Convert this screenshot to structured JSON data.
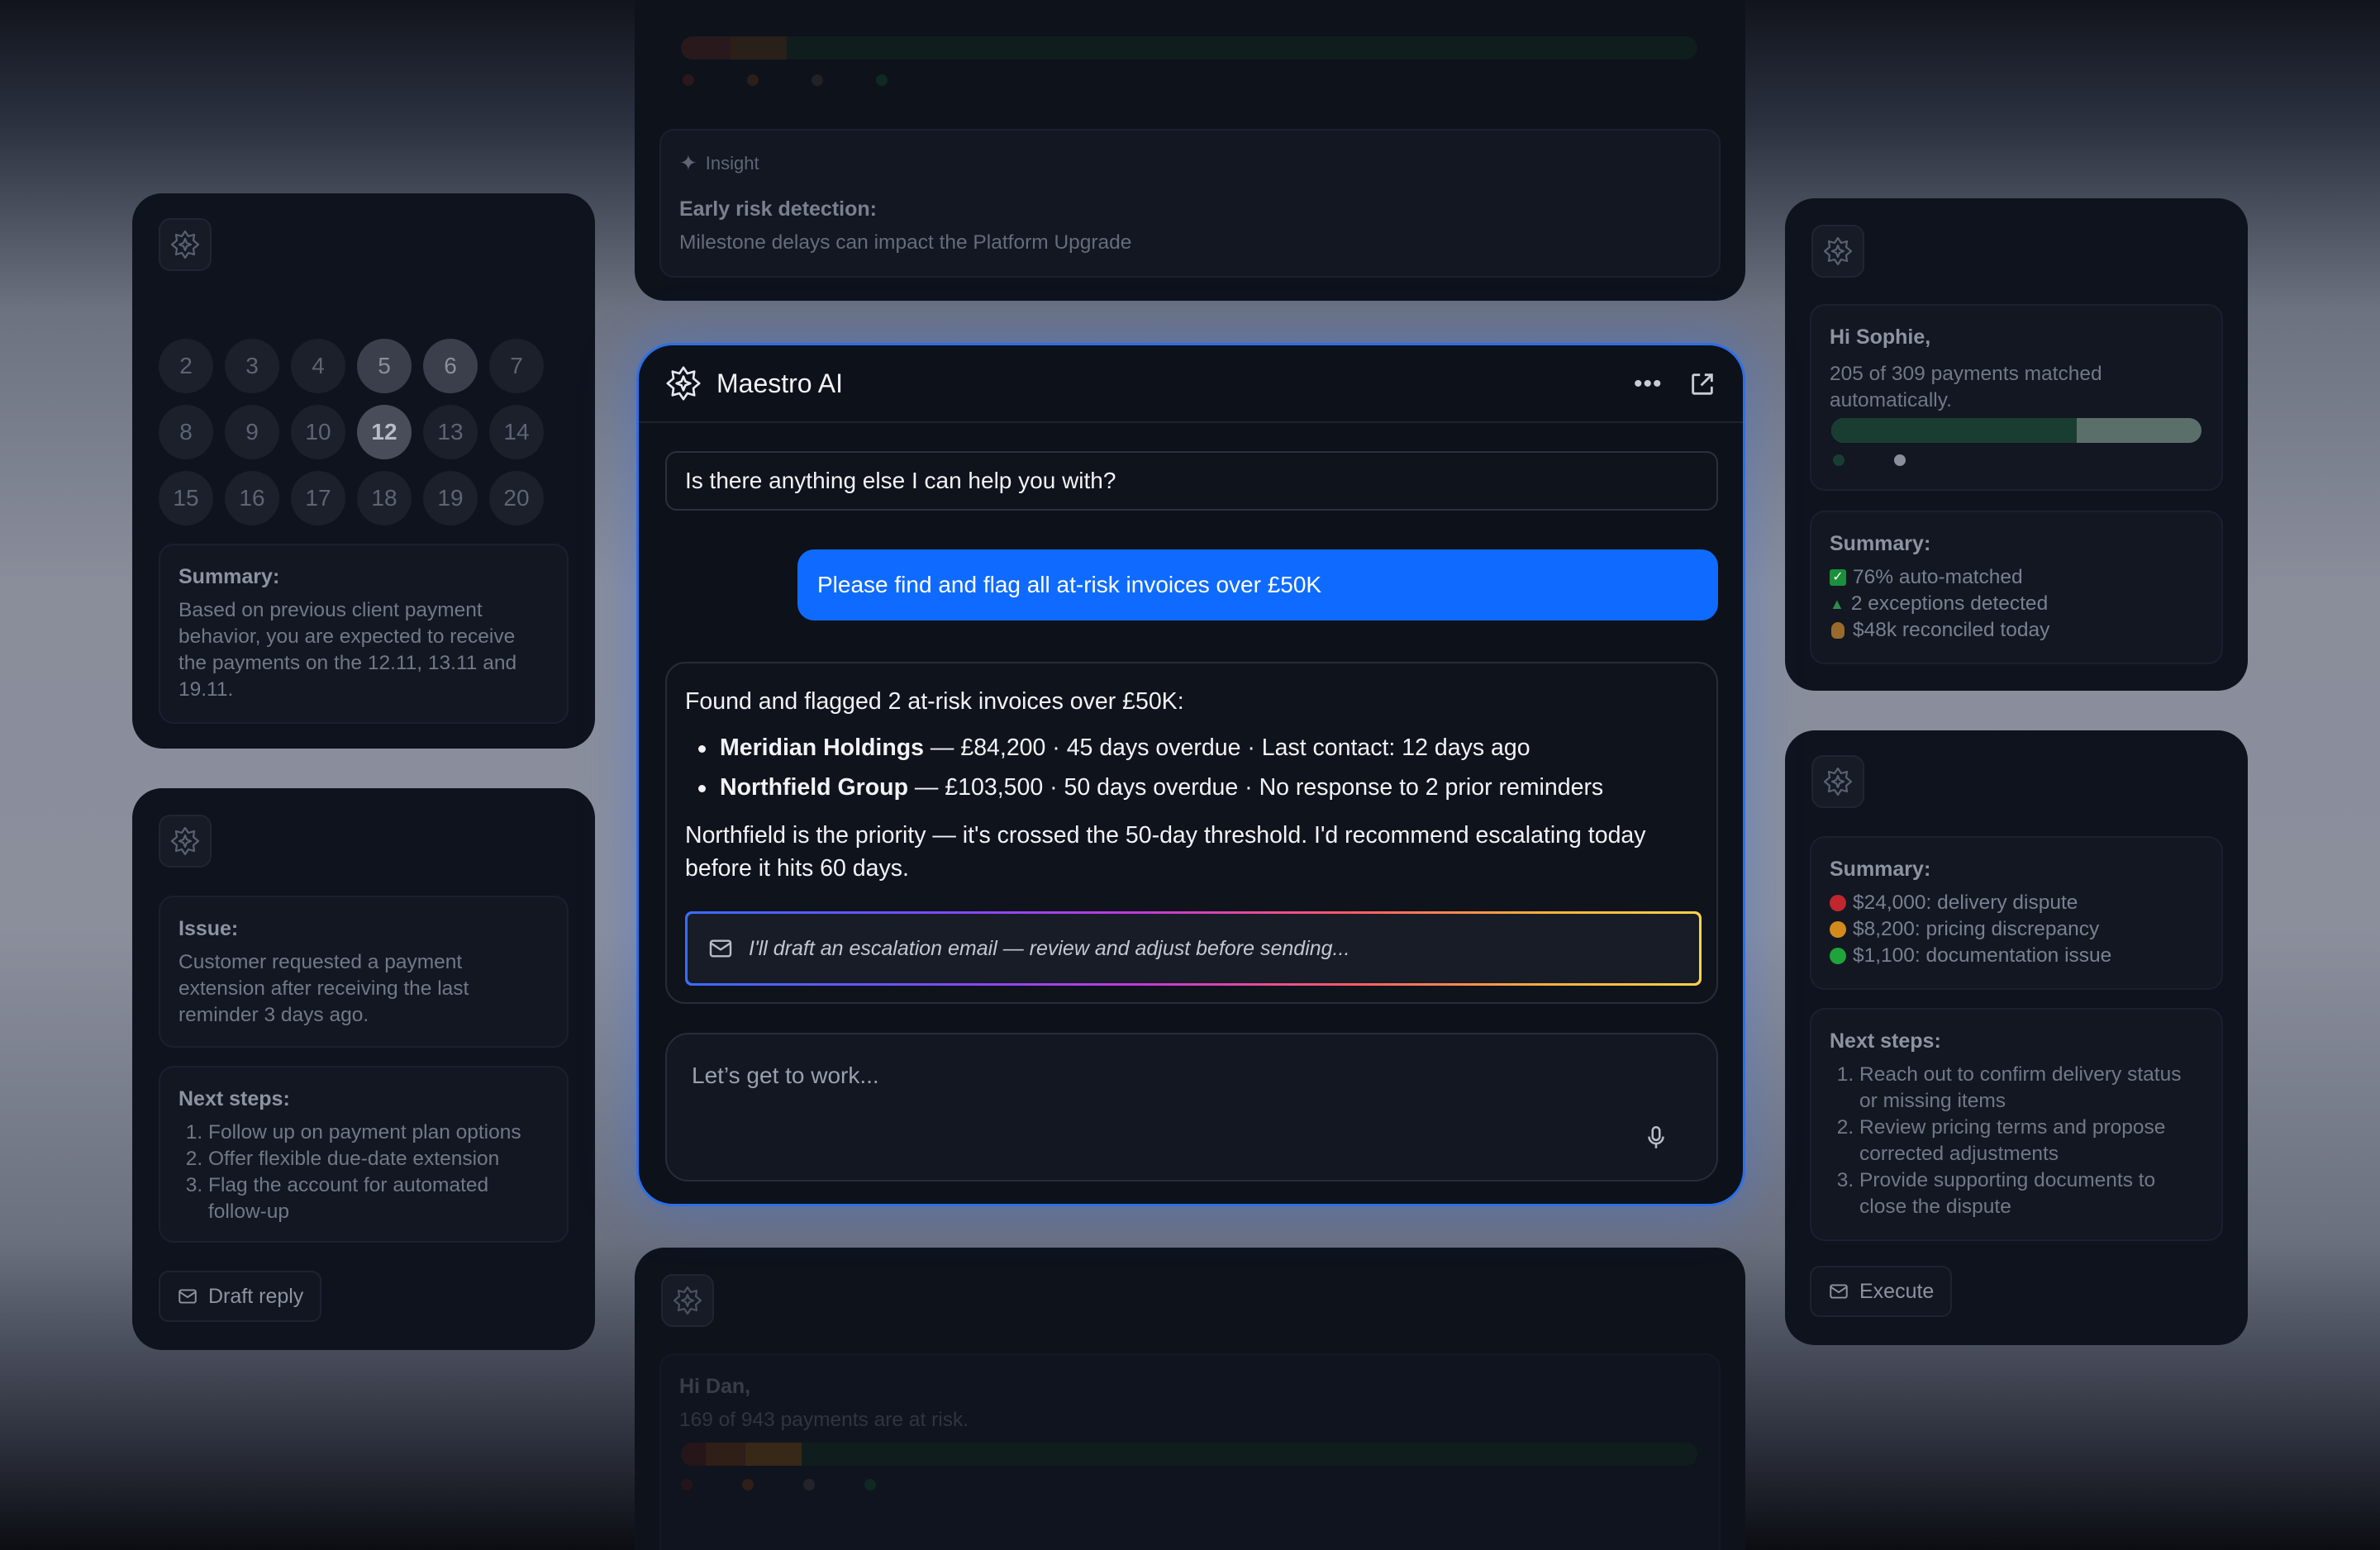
{
  "brand": {
    "accent": "#0f6bff",
    "border_glow": "#2d6fe8"
  },
  "top_panel": {
    "insight_tag": "Insight",
    "title": "Early risk detection:",
    "text": "Milestone delays can impact the Platform Upgrade"
  },
  "left_top": {
    "calendar": [
      "2",
      "3",
      "4",
      "5",
      "6",
      "7",
      "8",
      "9",
      "10",
      "12",
      "13",
      "14",
      "15",
      "16",
      "17",
      "18",
      "19",
      "20"
    ],
    "selected": [
      "5",
      "6",
      "12"
    ],
    "summary_title": "Summary:",
    "summary_text": "Based on previous client payment behavior, you are expected to receive the payments on the 12.11, 13.11 and 19.11."
  },
  "left_bottom": {
    "issue_title": "Issue:",
    "issue_text": "Customer requested a payment extension after receiving the last reminder 3 days ago.",
    "next_title": "Next steps:",
    "steps": [
      "Follow up on payment plan options",
      "Offer flexible due-date extension",
      "Flag the account for automated follow-up"
    ],
    "button": "Draft reply"
  },
  "chat": {
    "title": "Maestro AI",
    "assistant_prompt": "Is there anything else I can help you with?",
    "user_message": "Please find and flag all at-risk invoices over £50K",
    "answer_intro": "Found and flagged 2 at-risk invoices over £50K:",
    "items": [
      {
        "name": "Meridian Holdings",
        "detail": " — £84,200 · 45 days overdue · Last contact: 12 days ago"
      },
      {
        "name": "Northfield Group",
        "detail": " — £103,500 · 50 days overdue · No response to 2 prior reminders"
      }
    ],
    "recommendation": "Northfield is the priority — it's crossed the 50-day threshold. I'd recommend escalating today before it hits 60 days.",
    "draft_text": "I'll draft an escalation email — review and adjust before sending...",
    "input_placeholder": "Let’s get to work..."
  },
  "right_top": {
    "greeting": "Hi Sophie,",
    "text": "205 of 309 payments matched automatically.",
    "progress": {
      "matched": 205,
      "total": 309
    },
    "summary_title": "Summary:",
    "summary_items": [
      "76% auto-matched",
      "2 exceptions detected",
      "$48k reconciled today"
    ]
  },
  "right_bottom": {
    "summary_title": "Summary:",
    "summary_items": [
      "$24,000: delivery dispute",
      "$8,200: pricing discrepancy",
      "$1,100: documentation issue"
    ],
    "status_colors": [
      "#c0262d",
      "#d38a1c",
      "#1fa33a"
    ],
    "next_title": "Next steps:",
    "steps": [
      "Reach out to confirm delivery status or missing items",
      "Review pricing terms and propose corrected adjustments",
      "Provide supporting documents to close the dispute"
    ],
    "button": "Execute"
  },
  "bottom_panel": {
    "greeting": "Hi Dan,",
    "text": "169 of 943 payments are at risk."
  }
}
